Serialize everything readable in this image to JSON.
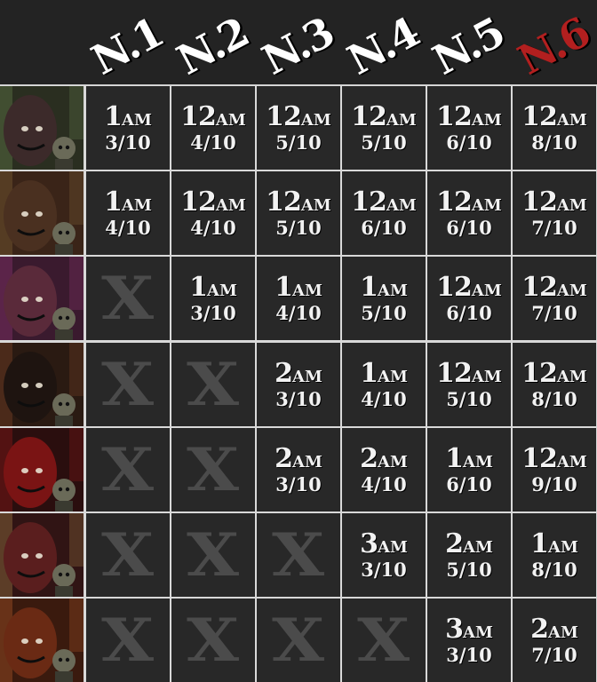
{
  "nights": [
    {
      "label": "N.1",
      "color": "#ffffff"
    },
    {
      "label": "N.2",
      "color": "#ffffff"
    },
    {
      "label": "N.3",
      "color": "#ffffff"
    },
    {
      "label": "N.4",
      "color": "#ffffff"
    },
    {
      "label": "N.5",
      "color": "#ffffff"
    },
    {
      "label": "N.6",
      "color": "#b21f1f"
    }
  ],
  "unavailable_mark": "X",
  "characters": [
    {
      "portrait": {
        "bg": "#2a2e20",
        "accent": "#6e8a52",
        "face": "#3c2a2a"
      },
      "cells": [
        {
          "hour": "1",
          "ampm": "AM",
          "difficulty": "3/10"
        },
        {
          "hour": "12",
          "ampm": "AM",
          "difficulty": "4/10"
        },
        {
          "hour": "12",
          "ampm": "AM",
          "difficulty": "5/10"
        },
        {
          "hour": "12",
          "ampm": "AM",
          "difficulty": "5/10"
        },
        {
          "hour": "12",
          "ampm": "AM",
          "difficulty": "6/10"
        },
        {
          "hour": "12",
          "ampm": "AM",
          "difficulty": "8/10"
        }
      ]
    },
    {
      "portrait": {
        "bg": "#3a2418",
        "accent": "#8a6a3a",
        "face": "#4a3020"
      },
      "cells": [
        {
          "hour": "1",
          "ampm": "AM",
          "difficulty": "4/10"
        },
        {
          "hour": "12",
          "ampm": "AM",
          "difficulty": "4/10"
        },
        {
          "hour": "12",
          "ampm": "AM",
          "difficulty": "5/10"
        },
        {
          "hour": "12",
          "ampm": "AM",
          "difficulty": "6/10"
        },
        {
          "hour": "12",
          "ampm": "AM",
          "difficulty": "6/10"
        },
        {
          "hour": "12",
          "ampm": "AM",
          "difficulty": "7/10"
        }
      ]
    },
    {
      "portrait": {
        "bg": "#3a1a2e",
        "accent": "#9a3a7a",
        "face": "#5a2a3a"
      },
      "cells": [
        null,
        {
          "hour": "1",
          "ampm": "AM",
          "difficulty": "3/10"
        },
        {
          "hour": "1",
          "ampm": "AM",
          "difficulty": "4/10"
        },
        {
          "hour": "1",
          "ampm": "AM",
          "difficulty": "5/10"
        },
        {
          "hour": "12",
          "ampm": "AM",
          "difficulty": "6/10"
        },
        {
          "hour": "12",
          "ampm": "AM",
          "difficulty": "7/10"
        }
      ]
    },
    {
      "portrait": {
        "bg": "#2a1a12",
        "accent": "#8a4a2a",
        "face": "#1e1410"
      },
      "cells": [
        null,
        null,
        {
          "hour": "2",
          "ampm": "AM",
          "difficulty": "3/10"
        },
        {
          "hour": "1",
          "ampm": "AM",
          "difficulty": "4/10"
        },
        {
          "hour": "12",
          "ampm": "AM",
          "difficulty": "5/10"
        },
        {
          "hour": "12",
          "ampm": "AM",
          "difficulty": "8/10"
        }
      ]
    },
    {
      "portrait": {
        "bg": "#2a0e0e",
        "accent": "#a01a1a",
        "face": "#7a1414"
      },
      "cells": [
        null,
        null,
        {
          "hour": "2",
          "ampm": "AM",
          "difficulty": "3/10"
        },
        {
          "hour": "2",
          "ampm": "AM",
          "difficulty": "4/10"
        },
        {
          "hour": "1",
          "ampm": "AM",
          "difficulty": "6/10"
        },
        {
          "hour": "12",
          "ampm": "AM",
          "difficulty": "9/10"
        }
      ]
    },
    {
      "portrait": {
        "bg": "#301414",
        "accent": "#b08a4a",
        "face": "#5a1e1e"
      },
      "cells": [
        null,
        null,
        null,
        {
          "hour": "3",
          "ampm": "AM",
          "difficulty": "3/10"
        },
        {
          "hour": "2",
          "ampm": "AM",
          "difficulty": "5/10"
        },
        {
          "hour": "1",
          "ampm": "AM",
          "difficulty": "8/10"
        }
      ]
    },
    {
      "portrait": {
        "bg": "#3a1a0e",
        "accent": "#c0602a",
        "face": "#6a2a14"
      },
      "cells": [
        null,
        null,
        null,
        null,
        {
          "hour": "3",
          "ampm": "AM",
          "difficulty": "3/10"
        },
        {
          "hour": "2",
          "ampm": "AM",
          "difficulty": "7/10"
        }
      ]
    }
  ]
}
